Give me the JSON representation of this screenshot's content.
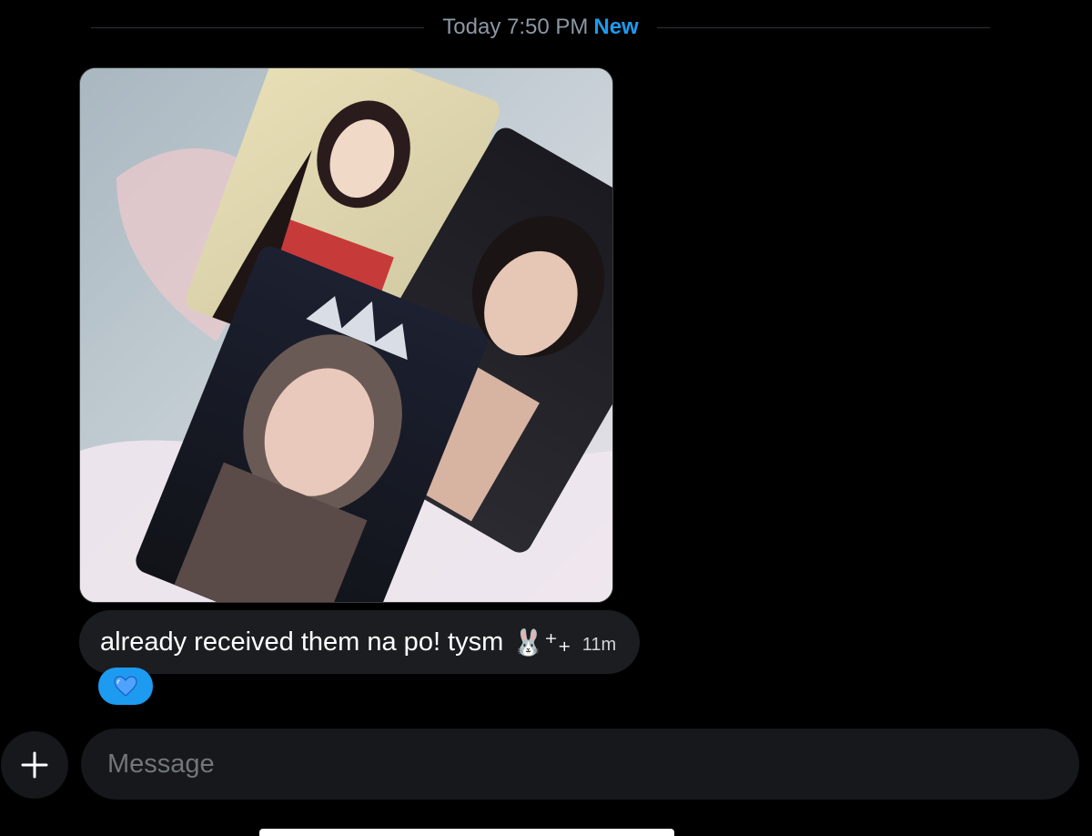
{
  "divider": {
    "timestamp": "Today 7:50 PM",
    "new_label": "New"
  },
  "message": {
    "text": "already received them na po! tysm",
    "emoji": "🐰⁺₊",
    "time": "11m"
  },
  "reaction": {
    "emoji": "blue-heart"
  },
  "composer": {
    "placeholder": "Message",
    "plus_icon": "plus-icon"
  },
  "colors": {
    "background": "#000000",
    "bubble": "#1b1d20",
    "accent": "#1d9bf0",
    "muted_text": "#8b98a5"
  }
}
